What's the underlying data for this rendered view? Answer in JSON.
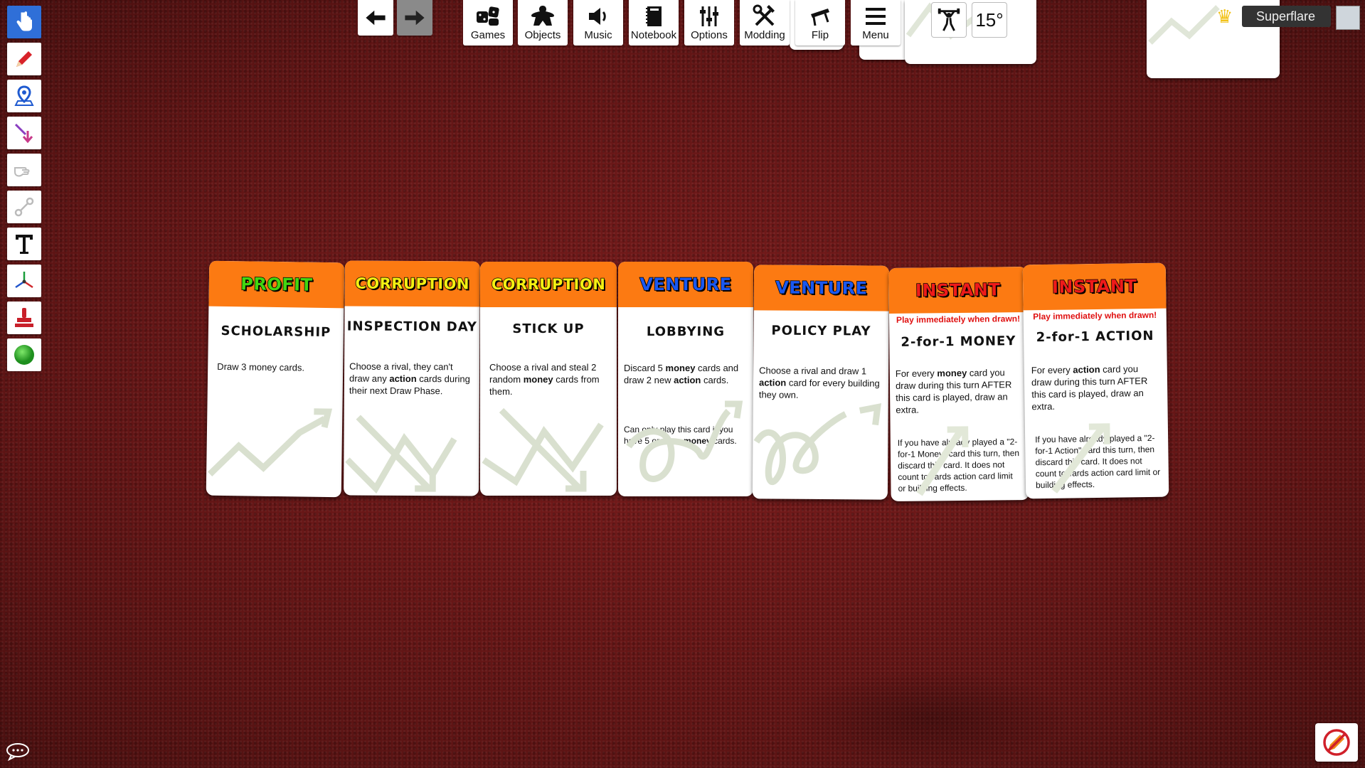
{
  "toolbar": {
    "games": "Games",
    "objects": "Objects",
    "music": "Music",
    "notebook": "Notebook",
    "options": "Options",
    "modding": "Modding",
    "flip": "Flip",
    "menu": "Menu",
    "rotation": "15°"
  },
  "player": {
    "name": "Superflare"
  },
  "colors": {
    "felt": "#6b1818",
    "card_header": "#fc7a12",
    "active_tool": "#2f6fd8"
  },
  "tools": [
    "grab-tool",
    "draw-tool",
    "ruler-pin-tool",
    "line-tool",
    "flick-tool",
    "joint-tool",
    "text-tool",
    "gizmo-tool",
    "snap-tool",
    "color-ball-tool"
  ],
  "cards": [
    {
      "category": "PROFIT",
      "name": "SCHOLARSHIP",
      "desc": "Draw 3 money cards.",
      "sub": "",
      "note": ""
    },
    {
      "category": "CORRUPTION",
      "name": "INSPECTION DAY",
      "desc_parts": [
        "Choose a rival, they can't draw any ",
        "action",
        " cards during their next Draw Phase."
      ],
      "sub": "",
      "note": ""
    },
    {
      "category": "CORRUPTION",
      "name": "STICK UP",
      "desc_parts": [
        "Choose a rival and steal 2 random ",
        "money",
        " cards from them."
      ],
      "sub": "",
      "note": ""
    },
    {
      "category": "VENTURE",
      "name": "LOBBYING",
      "desc_parts": [
        "Discard 5 ",
        "money",
        " cards and draw 2 new ",
        "action",
        " cards."
      ],
      "note_parts": [
        "Can only play this card if you have 5 or more ",
        "money",
        " cards."
      ]
    },
    {
      "category": "VENTURE",
      "name": "POLICY PLAY",
      "desc_parts": [
        "Choose a rival and draw 1 ",
        "action",
        " card for every building they own."
      ]
    },
    {
      "category": "INSTANT",
      "sub": "Play immediately when drawn!",
      "name": "2-for-1 MONEY",
      "desc_parts": [
        "For every ",
        "money",
        " card you draw during this turn AFTER this card is played, draw an extra."
      ],
      "note": "If you have already played a \"2-for-1 Money\" card this turn, then discard this card. It does not count towards action card limit or building effects."
    },
    {
      "category": "INSTANT",
      "sub": "Play immediately when drawn!",
      "name": "2-for-1 ACTION",
      "desc_parts": [
        "For every ",
        "action",
        " card you draw during this turn AFTER this card is played, draw an extra."
      ],
      "note": "If you have already played a \"2-for-1 Action\" card this turn, then discard this card. It does not count towards action card limit or building effects."
    }
  ]
}
